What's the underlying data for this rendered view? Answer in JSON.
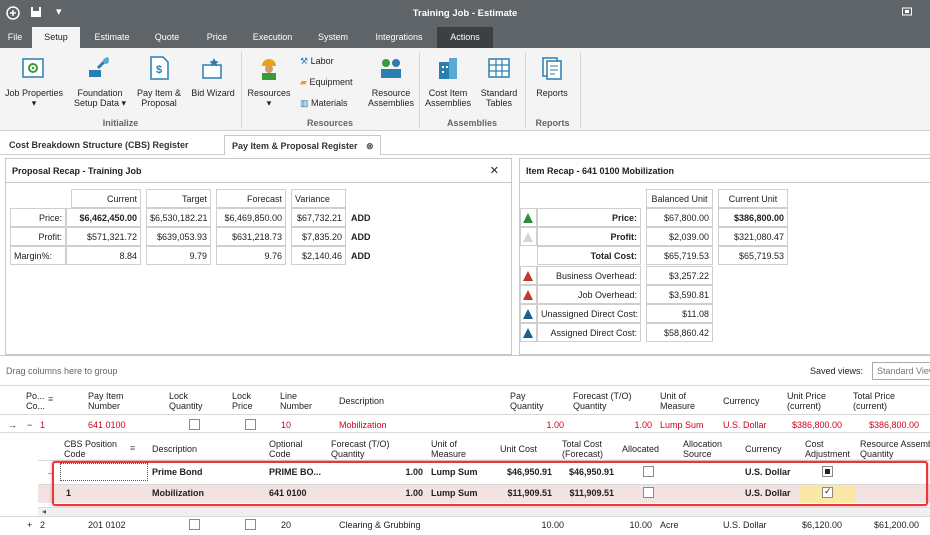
{
  "window": {
    "title": "Training Job - Estimate"
  },
  "menu": [
    {
      "label": "File"
    },
    {
      "label": "Setup"
    },
    {
      "label": "Estimate"
    },
    {
      "label": "Quote"
    },
    {
      "label": "Price"
    },
    {
      "label": "Execution"
    },
    {
      "label": "System"
    },
    {
      "label": "Integrations"
    },
    {
      "label": "Actions"
    }
  ],
  "ribbon": {
    "job_properties": "Job Properties",
    "foundation_setup_data": [
      "Foundation",
      "Setup Data"
    ],
    "pay_item_proposal": [
      "Pay Item &",
      "Proposal"
    ],
    "bid_wizard": "Bid Wizard",
    "resources": "Resources",
    "labor": "Labor",
    "equipment": "Equipment",
    "materials": "Materials",
    "resource_assemblies": [
      "Resource",
      "Assemblies"
    ],
    "cost_item_assemblies": [
      "Cost Item",
      "Assemblies"
    ],
    "standard_tables": [
      "Standard",
      "Tables"
    ],
    "reports": "Reports",
    "groups": {
      "initialize": "Initialize",
      "resources": "Resources",
      "assemblies": "Assemblies",
      "reports": "Reports"
    }
  },
  "tabs": [
    {
      "label": "Cost Breakdown Structure (CBS) Register"
    },
    {
      "label": "Pay Item & Proposal Register"
    }
  ],
  "proposal_recap": {
    "title": "Proposal Recap - Training Job",
    "columns": [
      "Current",
      "Target",
      "Forecast",
      "Variance"
    ],
    "rows": [
      {
        "label": "Price:",
        "current": "$6,462,450.00",
        "target": "$6,530,182.21",
        "forecast": "$6,469,850.00",
        "variance": "$67,732.21",
        "add": "ADD"
      },
      {
        "label": "Profit:",
        "current": "$571,321.72",
        "target": "$639,053.93",
        "forecast": "$631,218.73",
        "variance": "$7,835.20",
        "add": "ADD"
      },
      {
        "label": "Margin%:",
        "current": "8.84",
        "target": "9.79",
        "forecast": "9.76",
        "variance": "$2,140.46",
        "add": "ADD"
      }
    ]
  },
  "item_recap": {
    "title": "Item Recap - 641 0100 Mobilization",
    "columns": [
      "Balanced Unit",
      "Current Unit"
    ],
    "rows": [
      {
        "label": "Price:",
        "balanced": "$67,800.00",
        "current": "$386,800.00"
      },
      {
        "label": "Profit:",
        "balanced": "$2,039.00",
        "current": "$321,080.47"
      },
      {
        "label": "Total Cost:",
        "balanced": "$65,719.53",
        "current": "$65,719.53"
      },
      {
        "label": "Business Overhead:",
        "balanced": "$3,257.22",
        "current": ""
      },
      {
        "label": "Job Overhead:",
        "balanced": "$3,590.81",
        "current": ""
      },
      {
        "label": "Unassigned Direct Cost:",
        "balanced": "$11.08",
        "current": ""
      },
      {
        "label": "Assigned Direct Cost:",
        "balanced": "$58,860.42",
        "current": ""
      }
    ]
  },
  "grid": {
    "group_hint": "Drag columns here to group",
    "saved_views_label": "Saved views:",
    "saved_views_value": "Standard View",
    "columns": [
      "Po... Co...",
      "Pay Item Number",
      "Lock Quantity",
      "Lock Price",
      "Line Number",
      "Description",
      "Pay Quantity",
      "Forecast (T/O) Quantity",
      "Unit of Measure",
      "Currency",
      "Unit Price (current)",
      "Total Price (current)"
    ],
    "rows": [
      {
        "pos": "1",
        "pay_item": "641 0100",
        "line": "10",
        "description": "Mobilization",
        "pay_qty": "1.00",
        "forecast_qty": "1.00",
        "uom": "Lump Sum",
        "currency": "U.S. Dollar",
        "unit_price": "$386,800.00",
        "total_price": "$386,800.00"
      },
      {
        "pos": "2",
        "pay_item": "201 0102",
        "line": "20",
        "description": "Clearing & Grubbing",
        "pay_qty": "10.00",
        "forecast_qty": "10.00",
        "uom": "Acre",
        "currency": "U.S. Dollar",
        "unit_price": "$6,120.00",
        "total_price": "$61,200.00"
      }
    ],
    "sub_columns": [
      "CBS Position Code",
      "Description",
      "Optional Code",
      "Forecast (T/O) Quantity",
      "Unit of Measure",
      "Unit Cost",
      "Total Cost (Forecast)",
      "Allocated",
      "Allocation Source",
      "Currency",
      "Cost Adjustment",
      "Resource Assembly Quantity"
    ],
    "sub_rows": [
      {
        "cbs": "",
        "description": "Prime Bond",
        "optional": "PRIME BO...",
        "forecast_qty": "1.00",
        "uom": "Lump Sum",
        "unit_cost": "$46,950.91",
        "total_cost": "$46,950.91",
        "currency": "U.S. Dollar"
      },
      {
        "cbs": "1",
        "description": "Mobilization",
        "optional": "641 0100",
        "forecast_qty": "1.00",
        "uom": "Lump Sum",
        "unit_cost": "$11,909.51",
        "total_cost": "$11,909.51",
        "currency": "U.S. Dollar"
      }
    ]
  },
  "colors": {
    "titlebar": "#5f6468",
    "accent_red": "#d0021b",
    "highlight": "#e8383d"
  }
}
